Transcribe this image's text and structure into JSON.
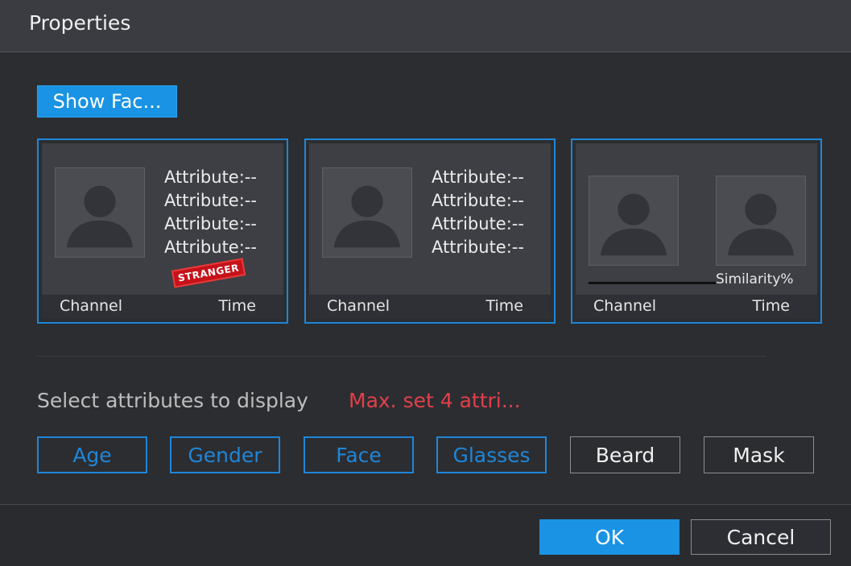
{
  "dialog": {
    "title": "Properties"
  },
  "show_face_button": "Show Fac...",
  "cards": [
    {
      "attributes": [
        "Attribute:--",
        "Attribute:--",
        "Attribute:--",
        "Attribute:--"
      ],
      "channel": "Channel",
      "time": "Time",
      "stamp": "STRANGER"
    },
    {
      "attributes": [
        "Attribute:--",
        "Attribute:--",
        "Attribute:--",
        "Attribute:--"
      ],
      "channel": "Channel",
      "time": "Time"
    },
    {
      "similarity": "Similarity%",
      "channel": "Channel",
      "time": "Time"
    }
  ],
  "select_label": "Select attributes to display",
  "max_label": "Max. set 4 attri...",
  "attribute_buttons": [
    {
      "label": "Age",
      "selected": true
    },
    {
      "label": "Gender",
      "selected": true
    },
    {
      "label": "Face",
      "selected": true
    },
    {
      "label": "Glasses",
      "selected": true
    },
    {
      "label": "Beard",
      "selected": false
    },
    {
      "label": "Mask",
      "selected": false
    }
  ],
  "footer": {
    "ok": "OK",
    "cancel": "Cancel"
  },
  "colors": {
    "accent": "#1a93e4",
    "background": "#2c2d31",
    "warning": "#e0404b"
  },
  "icons": {
    "portrait": "person-silhouette-icon"
  }
}
